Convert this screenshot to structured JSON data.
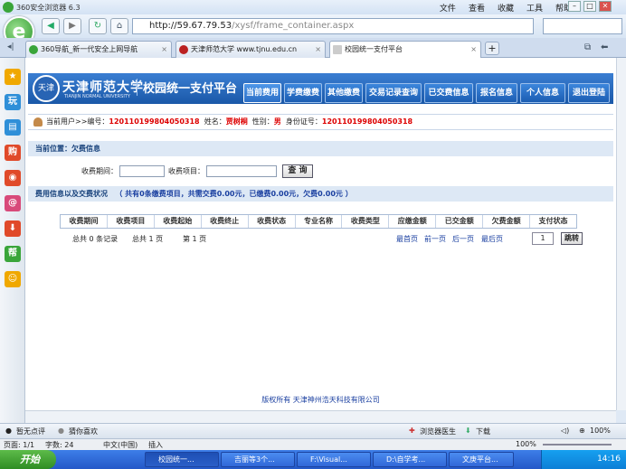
{
  "browser": {
    "title": "360安全浏览器 6.3",
    "menu": [
      "文件",
      "查看",
      "收藏",
      "工具",
      "帮助"
    ],
    "address": {
      "host": "http://59.67.79.53",
      "path": "/xysf/frame_container.aspx"
    },
    "tabs": [
      {
        "label": "360导航_新一代安全上网导航",
        "active": false
      },
      {
        "label": "天津师范大学 www.tjnu.edu.cn",
        "active": false
      },
      {
        "label": "校园统一支付平台",
        "active": true
      }
    ],
    "new_tab": "+"
  },
  "sidebar": {
    "items": [
      {
        "icon": "star-icon",
        "label": "★",
        "color": "#f0a800"
      },
      {
        "icon": "play-icon",
        "label": "玩",
        "color": "#2f8fd8"
      },
      {
        "icon": "book-icon",
        "label": "▤",
        "color": "#2f8fd8"
      },
      {
        "icon": "shop-icon",
        "label": "购",
        "color": "#e04a2a"
      },
      {
        "icon": "weibo-icon",
        "label": "◉",
        "color": "#e04a2a"
      },
      {
        "icon": "mail-icon",
        "label": "@",
        "color": "#d84a7a"
      },
      {
        "icon": "download-icon",
        "label": "⬇",
        "color": "#e04a2a"
      },
      {
        "icon": "help-icon",
        "label": "帮",
        "color": "#3aa53a"
      },
      {
        "icon": "face-icon",
        "label": "☺",
        "color": "#f0a800"
      }
    ]
  },
  "site": {
    "logo_text": "天津",
    "name": "天津师范大学",
    "name_en": "TIANJIN NORMAL UNIVERSITY",
    "system": "校园统一支付平台",
    "menu": [
      {
        "label": "当前费用",
        "current": true
      },
      {
        "label": "学费缴费",
        "current": false
      },
      {
        "label": "其他缴费",
        "current": false
      },
      {
        "label": "交易记录查询",
        "current": false
      },
      {
        "label": "已交费信息",
        "current": false
      },
      {
        "label": "报名信息",
        "current": false
      },
      {
        "label": "个人信息",
        "current": false
      },
      {
        "label": "退出登陆",
        "current": false
      }
    ]
  },
  "user": {
    "prefix": "当前用户>>编号：",
    "id": "120110199804050318",
    "name_label": "姓名：",
    "name": "贾树桐",
    "gender_label": "性别：",
    "gender": "男",
    "idcard_label": "身份证号：",
    "idcard": "120110199804050318"
  },
  "location": "当前位置：欠费信息",
  "query": {
    "period_label": "收费期间：",
    "item_label": "收费项目：",
    "period_value": "",
    "item_value": "",
    "button": "查  询"
  },
  "summary": {
    "label": "费用信息以及交费状况",
    "text": "（ 共有0条缴费项目，共需交费0.00元，已缴费0.00元，欠费0.00元 ）"
  },
  "table": {
    "headers": [
      "收费期间",
      "收费项目",
      "收费起始",
      "收费终止",
      "收费状态",
      "专业名称",
      "收费类型",
      "应缴金额",
      "已交金额",
      "欠费金额",
      "支付状态"
    ],
    "rows": []
  },
  "pager": {
    "total": "总共 0 条记录",
    "pages": "总共 1 页",
    "current": "第 1 页",
    "first": "最首页",
    "prev": "前一页",
    "next": "后一页",
    "last": "最后页",
    "page_input": "1",
    "go": "跳转"
  },
  "footer": "版权所有 天津神州浩天科技有限公司",
  "status": {
    "left1": "暂无点评",
    "left2": "猜你喜欢",
    "doctor": "浏览器医生",
    "download": "下载",
    "zoom": "100%",
    "page": "页面: 1/1",
    "chars": "字数: 24",
    "lang": "中文(中国)",
    "insert": "插入",
    "zoom2": "100%"
  },
  "taskbar": {
    "start": "开始",
    "tasks": [
      "校园统一...",
      "吉丽等3个...",
      "F:\\Visual...",
      "D:\\自学考...",
      "文庚平台..."
    ],
    "time": "14:16"
  }
}
